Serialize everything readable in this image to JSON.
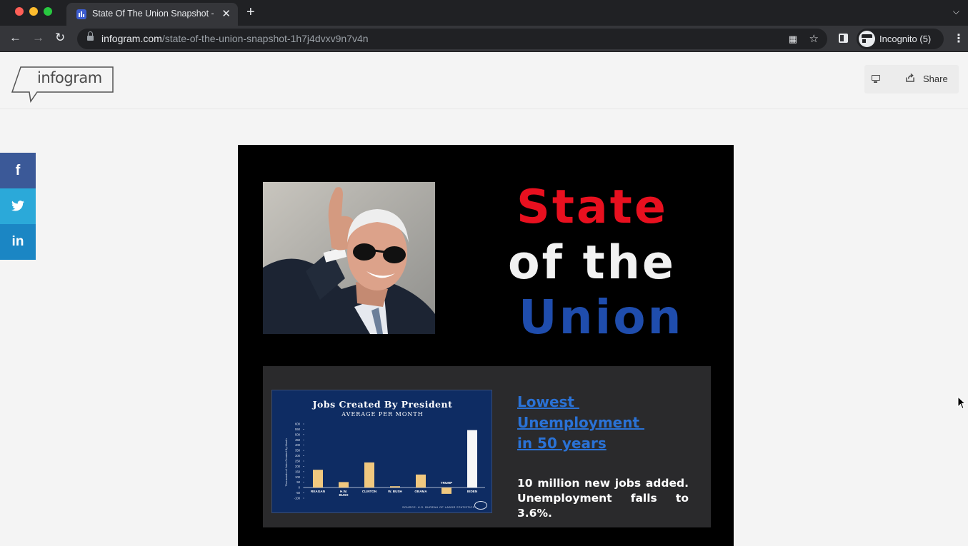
{
  "browser": {
    "tab_title": "State Of The Union Snapshot - Infogram",
    "tab_close": "✕",
    "new_tab": "+",
    "url_domain": "infogram.com",
    "url_path": "/state-of-the-union-snapshot-1h7j4dvxv9n7v4n",
    "profile_label": "Incognito (5)",
    "icons": [
      "back-icon",
      "forward-icon",
      "reload-icon",
      "lock-icon",
      "qr-code-icon",
      "bookmark-star-icon",
      "side-panel-icon",
      "incognito-icon",
      "kebab-menu-icon",
      "tab-list-chevron-icon"
    ]
  },
  "header": {
    "logo_text": "infogram",
    "share_label": "Share"
  },
  "social": {
    "facebook": "f",
    "linkedin": "in"
  },
  "infographic": {
    "title_line1": "State",
    "title_line2": "of the",
    "title_line3": "Union",
    "title_colors": [
      "#e8101f",
      "#f2f2f2",
      "#1f4dad"
    ],
    "headline": "Lowest \nUnemployment \nin 50 years",
    "body": "10 million new jobs added. Unemployment falls to 3.6%."
  },
  "chart": {
    "title": "Jobs Created By President",
    "subtitle": "AVERAGE PER MONTH",
    "source": "SOURCE: U.S. BUREAU OF LABOR STATISTICS"
  },
  "chart_data": {
    "type": "bar",
    "title": "Jobs Created By President",
    "subtitle": "AVERAGE PER MONTH",
    "ylabel": "Thousands of Jobs Created By Month",
    "ylim": [
      -100,
      600
    ],
    "yticks": [
      -100,
      -50,
      0,
      50,
      100,
      150,
      200,
      250,
      300,
      350,
      400,
      450,
      500,
      550,
      600
    ],
    "categories": [
      "REAGAN",
      "H.W. BUSH",
      "CLINTON",
      "W. BUSH",
      "OBAMA",
      "TRUMP",
      "BIDEN"
    ],
    "values": [
      168,
      52,
      237,
      13,
      123,
      -59,
      542
    ],
    "colors": [
      "#f0c87f",
      "#f0c87f",
      "#f0c87f",
      "#f0c87f",
      "#f0c87f",
      "#f0c87f",
      "#f7f7f7"
    ],
    "grid": false
  }
}
